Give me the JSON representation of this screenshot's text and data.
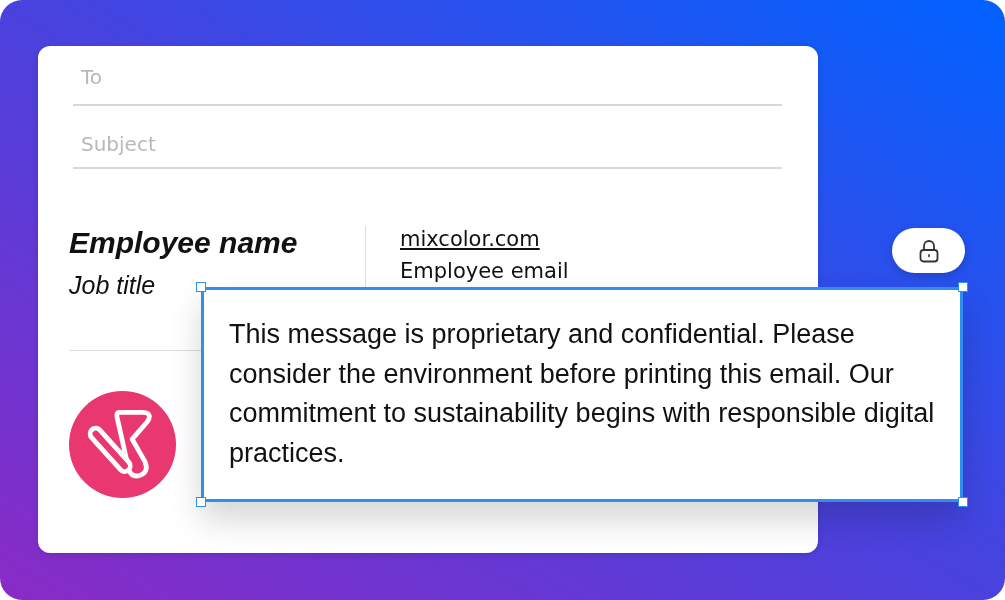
{
  "compose": {
    "to": {
      "placeholder": "To"
    },
    "subject": {
      "placeholder": "Subject"
    }
  },
  "signature": {
    "name": "Employee name",
    "job_title": "Job title",
    "website": "mixcolor.com",
    "email": "Employee email"
  },
  "lock_button": {
    "locked": true
  },
  "disclaimer": {
    "text": "This message is proprietary and confidential. Please consider the environment before printing this email. Our commitment to sustainability begins with responsible digital practices.",
    "selected": true
  }
}
